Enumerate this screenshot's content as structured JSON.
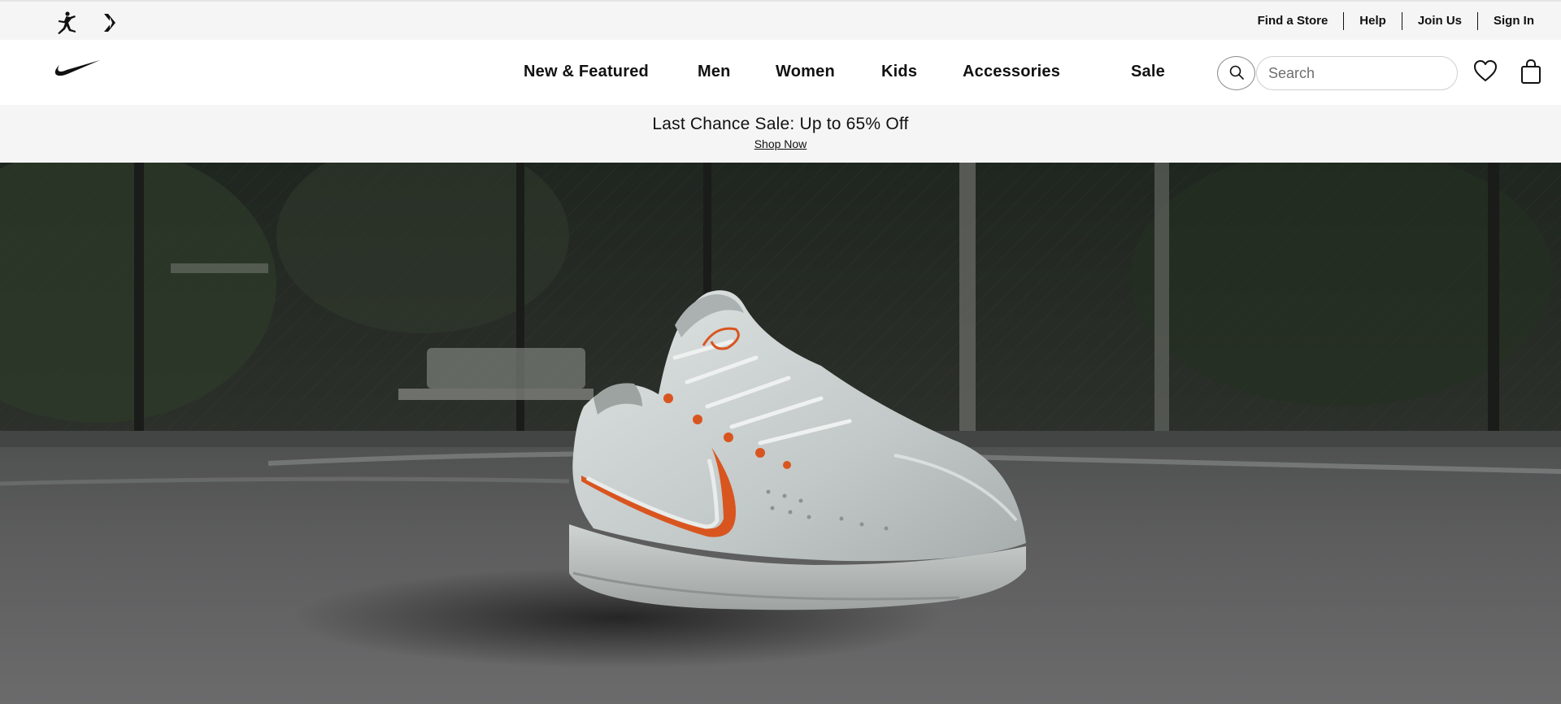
{
  "brands": [
    {
      "icon": "jordan-jumpman-icon"
    },
    {
      "icon": "converse-icon"
    }
  ],
  "utility_links": [
    "Find a Store",
    "Help",
    "Join Us",
    "Sign In"
  ],
  "logo": {
    "icon": "nike-swoosh-icon"
  },
  "nav": {
    "items": [
      "New & Featured",
      "Men",
      "Women",
      "Kids",
      "Accessories",
      "Sale"
    ]
  },
  "search": {
    "placeholder": "Search",
    "icon": "search-icon"
  },
  "actions": {
    "favorites_icon": "heart-icon",
    "bag_icon": "shopping-bag-icon"
  },
  "promo": {
    "title": "Last Chance Sale: Up to 65% Off",
    "link": "Shop Now"
  },
  "hero": {
    "image": "white basketball sneaker with orange swoosh on outdoor court"
  },
  "colors": {
    "accent": "#d9551f",
    "text": "#111111",
    "strip_bg": "#f5f5f5"
  }
}
